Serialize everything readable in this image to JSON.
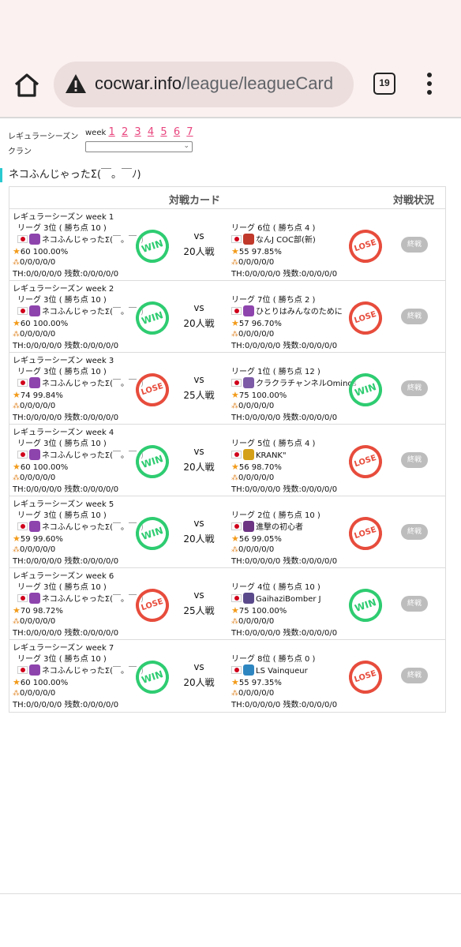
{
  "browser": {
    "url_domain": "cocwar.info",
    "url_path": "/league/leagueCard",
    "tab_count": "19"
  },
  "filters": {
    "season_label": "レギュラーシーズン",
    "week_label": "week",
    "weeks": [
      "1",
      "2",
      "3",
      "4",
      "5",
      "6",
      "7"
    ],
    "clan_label": "クラン",
    "clan_value": ""
  },
  "clan_heading": "ネコふんじゃったΣ(￣。￣ﾉ)",
  "table": {
    "col_card": "対戦カード",
    "col_status": "対戦状況"
  },
  "matches": [
    {
      "week": "レギュラーシーズン week 1",
      "h_rank": "リーグ 3位 ( 勝ち点 10 )",
      "h_name": "ネコふんじゃったΣ(￣。￣ﾉ)",
      "h_stars": "60 100.00%",
      "h_dmg": "0/0/0/0/0",
      "h_th": "TH:0/0/0/0/0 残数:0/0/0/0/0",
      "h_result": "WIN",
      "h_badge": "#8e44ad",
      "vs": "vs",
      "size": "20人戦",
      "a_rank": "リーグ 6位 ( 勝ち点 4 )",
      "a_name": "なんJ COC部(新)",
      "a_stars": "55 97.85%",
      "a_dmg": "0/0/0/0/0",
      "a_th": "TH:0/0/0/0/0 残数:0/0/0/0/0",
      "a_result": "LOSE",
      "a_badge": "#c0392b",
      "status": "終戦"
    },
    {
      "week": "レギュラーシーズン week 2",
      "h_rank": "リーグ 3位 ( 勝ち点 10 )",
      "h_name": "ネコふんじゃったΣ(￣。￣ﾉ)",
      "h_stars": "60 100.00%",
      "h_dmg": "0/0/0/0/0",
      "h_th": "TH:0/0/0/0/0 残数:0/0/0/0/0",
      "h_result": "WIN",
      "h_badge": "#8e44ad",
      "vs": "vs",
      "size": "20人戦",
      "a_rank": "リーグ 7位 ( 勝ち点 2 )",
      "a_name": "ひとりはみんなのために",
      "a_stars": "57 96.70%",
      "a_dmg": "0/0/0/0/0",
      "a_th": "TH:0/0/0/0/0 残数:0/0/0/0/0",
      "a_result": "LOSE",
      "a_badge": "#8e44ad",
      "status": "終戦"
    },
    {
      "week": "レギュラーシーズン week 3",
      "h_rank": "リーグ 3位 ( 勝ち点 10 )",
      "h_name": "ネコふんじゃったΣ(￣。￣ﾉ)",
      "h_stars": "74 99.84%",
      "h_dmg": "0/0/0/0/0",
      "h_th": "TH:0/0/0/0/0 残数:0/0/0/0/0",
      "h_result": "LOSE",
      "h_badge": "#8e44ad",
      "vs": "vs",
      "size": "25人戦",
      "a_rank": "リーグ 1位 ( 勝ち点 12 )",
      "a_name": "クラクラチャンネルOminos",
      "a_stars": "75 100.00%",
      "a_dmg": "0/0/0/0/0",
      "a_th": "TH:0/0/0/0/0 残数:0/0/0/0/0",
      "a_result": "WIN",
      "a_badge": "#7d5ba6",
      "status": "終戦"
    },
    {
      "week": "レギュラーシーズン week 4",
      "h_rank": "リーグ 3位 ( 勝ち点 10 )",
      "h_name": "ネコふんじゃったΣ(￣。￣ﾉ)",
      "h_stars": "60 100.00%",
      "h_dmg": "0/0/0/0/0",
      "h_th": "TH:0/0/0/0/0 残数:0/0/0/0/0",
      "h_result": "WIN",
      "h_badge": "#8e44ad",
      "vs": "vs",
      "size": "20人戦",
      "a_rank": "リーグ 5位 ( 勝ち点 4 )",
      "a_name": "KRANK\"",
      "a_stars": "56 98.70%",
      "a_dmg": "0/0/0/0/0",
      "a_th": "TH:0/0/0/0/0 残数:0/0/0/0/0",
      "a_result": "LOSE",
      "a_badge": "#d4a017",
      "status": "終戦"
    },
    {
      "week": "レギュラーシーズン week 5",
      "h_rank": "リーグ 3位 ( 勝ち点 10 )",
      "h_name": "ネコふんじゃったΣ(￣。￣ﾉ)",
      "h_stars": "59 99.60%",
      "h_dmg": "0/0/0/0/0",
      "h_th": "TH:0/0/0/0/0 残数:0/0/0/0/0",
      "h_result": "WIN",
      "h_badge": "#8e44ad",
      "vs": "vs",
      "size": "20人戦",
      "a_rank": "リーグ 2位 ( 勝ち点 10 )",
      "a_name": "進撃の初心者",
      "a_stars": "56 99.05%",
      "a_dmg": "0/0/0/0/0",
      "a_th": "TH:0/0/0/0/0 残数:0/0/0/0/0",
      "a_result": "LOSE",
      "a_badge": "#6c3483",
      "status": "終戦"
    },
    {
      "week": "レギュラーシーズン week 6",
      "h_rank": "リーグ 3位 ( 勝ち点 10 )",
      "h_name": "ネコふんじゃったΣ(￣。￣ﾉ)",
      "h_stars": "70 98.72%",
      "h_dmg": "0/0/0/0/0",
      "h_th": "TH:0/0/0/0/0 残数:0/0/0/0/0",
      "h_result": "LOSE",
      "h_badge": "#8e44ad",
      "vs": "vs",
      "size": "25人戦",
      "a_rank": "リーグ 4位 ( 勝ち点 10 )",
      "a_name": "GaihaziBomber J",
      "a_stars": "75 100.00%",
      "a_dmg": "0/0/0/0/0",
      "a_th": "TH:0/0/0/0/0 残数:0/0/0/0/0",
      "a_result": "WIN",
      "a_badge": "#5b4a8b",
      "status": "終戦"
    },
    {
      "week": "レギュラーシーズン week 7",
      "h_rank": "リーグ 3位 ( 勝ち点 10 )",
      "h_name": "ネコふんじゃったΣ(￣。￣ﾉ)",
      "h_stars": "60 100.00%",
      "h_dmg": "0/0/0/0/0",
      "h_th": "TH:0/0/0/0/0 残数:0/0/0/0/0",
      "h_result": "WIN",
      "h_badge": "#8e44ad",
      "vs": "vs",
      "size": "20人戦",
      "a_rank": "リーグ 8位 ( 勝ち点 0 )",
      "a_name": "LS Vainqueur",
      "a_stars": "55 97.35%",
      "a_dmg": "0/0/0/0/0",
      "a_th": "TH:0/0/0/0/0 残数:0/0/0/0/0",
      "a_result": "LOSE",
      "a_badge": "#2e86c1",
      "status": "終戦"
    }
  ]
}
